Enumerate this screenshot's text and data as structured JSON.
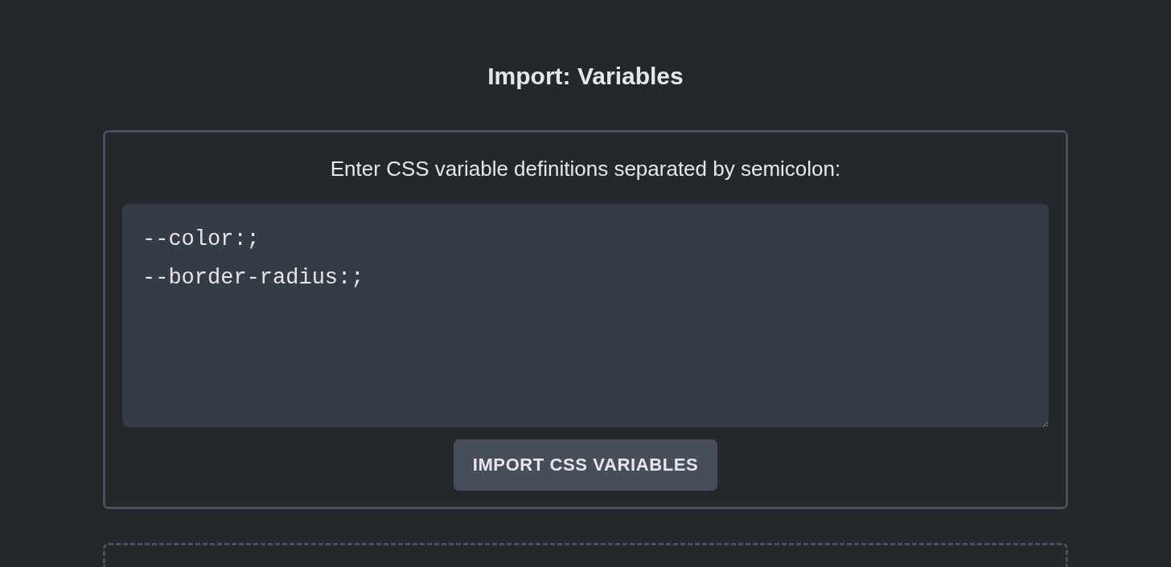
{
  "page": {
    "title": "Import: Variables"
  },
  "import_panel": {
    "instruction": "Enter CSS variable definitions separated by semicolon:",
    "textarea": {
      "value": "--color:;\n--border-radius:;"
    },
    "button": {
      "label": "IMPORT CSS VARIABLES"
    }
  }
}
